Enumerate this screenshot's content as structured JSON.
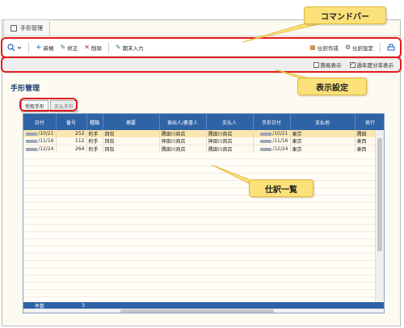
{
  "doc_tab": {
    "label": "手形管理"
  },
  "toolbar": {
    "new_label": "新規",
    "edit_label": "修正",
    "delete_label": "削除",
    "bulk_label": "期末入力",
    "journal_create_label": "仕訳作成",
    "journal_settings_label": "仕訳設定"
  },
  "options": {
    "simple_display": {
      "label": "簡易表示",
      "checked": false
    },
    "fiscal_split": {
      "label": "過年度分非表示",
      "checked": true
    }
  },
  "page_title": "手形管理",
  "subtabs": [
    "受取手形",
    "支払手形"
  ],
  "table": {
    "headers": [
      "日付",
      "番号",
      "種類",
      "摘要",
      "振出人/裏書人",
      "支払人",
      "手形日付",
      "支払地",
      "発行"
    ],
    "rows": [
      {
        "date": "/10/21",
        "num": "252",
        "kind": "約手",
        "memo": "回収",
        "drawer": "隅田川商店",
        "payer": "隅田川商店",
        "due": "/10/21",
        "place": "東京",
        "issuer": "隅田",
        "selected": true
      },
      {
        "date": "/11/16",
        "num": "112",
        "kind": "約手",
        "memo": "回収",
        "drawer": "神田川商店",
        "payer": "神田川商店",
        "due": "/11/16",
        "place": "東京",
        "issuer": "東西",
        "selected": false
      },
      {
        "date": "/12/24",
        "num": "264",
        "kind": "約手",
        "memo": "回収",
        "drawer": "隅田川商店",
        "payer": "隅田川商店",
        "due": "/12/24",
        "place": "東京",
        "issuer": "東西",
        "selected": false
      }
    ],
    "footer_label": "件数",
    "footer_count": "3"
  },
  "callouts": {
    "command_bar": "コマンドバー",
    "display_settings": "表示設定",
    "journal_list": "仕訳一覧"
  },
  "colors": {
    "header_blue": "#2e63a5",
    "highlight": "#e21b1b",
    "callout": "#fbe17a"
  }
}
